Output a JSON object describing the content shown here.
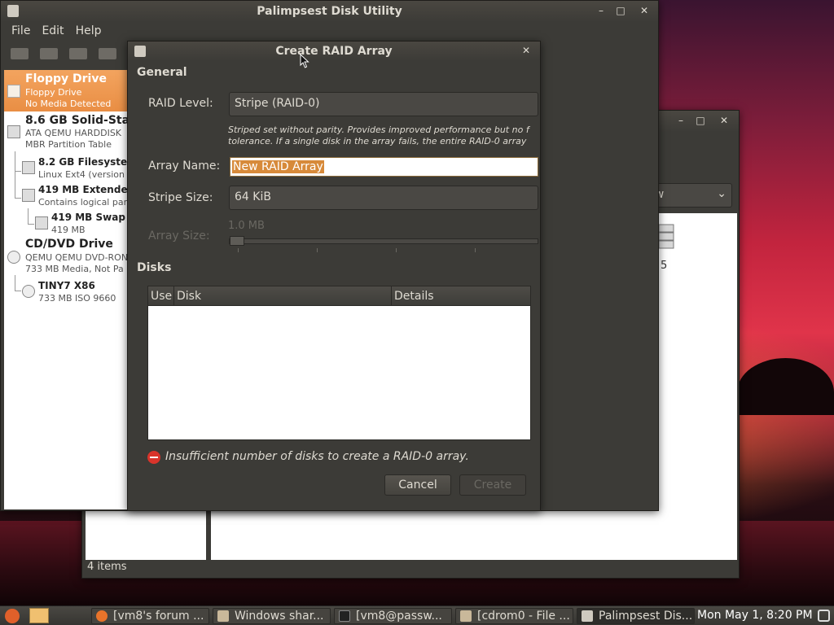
{
  "palimpsest": {
    "title": "Palimpsest Disk Utility",
    "menu": [
      "File",
      "Edit",
      "Help"
    ],
    "sidebar": [
      {
        "name": "Floppy Drive",
        "sub1": "Floppy Drive",
        "sub2": "No Media Detected",
        "icon": "floppy-icon"
      },
      {
        "name": "8.6 GB Solid-Sta",
        "sub1": "ATA QEMU HARDDISK",
        "sub2": "MBR Partition Table",
        "icon": "harddisk-icon"
      },
      {
        "name": "8.2 GB Filesysten",
        "sub1": "Linux Ext4 (version",
        "icon": "partition-icon"
      },
      {
        "name": "419 MB Extended",
        "sub1": "Contains logical par",
        "icon": "partition-icon"
      },
      {
        "name": "419 MB Swap S",
        "sub1": "419 MB",
        "icon": "partition-icon"
      },
      {
        "name": "CD/DVD Drive",
        "sub1": "QEMU QEMU DVD-RON",
        "sub2": "733 MB Media, Not Pa",
        "icon": "optical-drive-icon"
      },
      {
        "name": "TINY7 X86",
        "sub1": "733 MB ISO 9660",
        "icon": "disc-icon"
      }
    ]
  },
  "dialog": {
    "title": "Create RAID Array",
    "general_heading": "General",
    "raid_level_label": "RAID Level:",
    "raid_level_value": "Stripe (RAID-0)",
    "hint_line1": "Striped set without parity. Provides improved performance but no f",
    "hint_line2": "tolerance. If a single disk in the array fails, the entire RAID-0 array",
    "array_name_label": "Array Name:",
    "array_name_value": "New RAID Array",
    "stripe_size_label": "Stripe Size:",
    "stripe_size_value": "64 KiB",
    "array_size_label": "Array Size:",
    "array_size_value": "1.0 MB",
    "disks_heading": "Disks",
    "columns": [
      "Use",
      "Disk",
      "Details"
    ],
    "error_text": "Insufficient number of disks to create a RAID-0 array.",
    "cancel_label": "Cancel",
    "create_label": "Create"
  },
  "nautilus": {
    "view_label": "View",
    "status": "4 items",
    "drive_number": "5"
  },
  "panel": {
    "tasks": [
      {
        "label": "[vm8's forum ...",
        "icon": "firefox-icon"
      },
      {
        "label": "Windows shar...",
        "icon": "folder-icon"
      },
      {
        "label": "[vm8@passw...",
        "icon": "terminal-icon"
      },
      {
        "label": "[cdrom0 - File ...",
        "icon": "folder-icon"
      },
      {
        "label": "Palimpsest Dis...",
        "icon": "disk-utility-icon"
      }
    ],
    "clock": "Mon May  1,  8:20 PM"
  },
  "colors": {
    "selection": "#e98e44",
    "window_bg": "#3c3b37",
    "error": "#d9342b"
  }
}
